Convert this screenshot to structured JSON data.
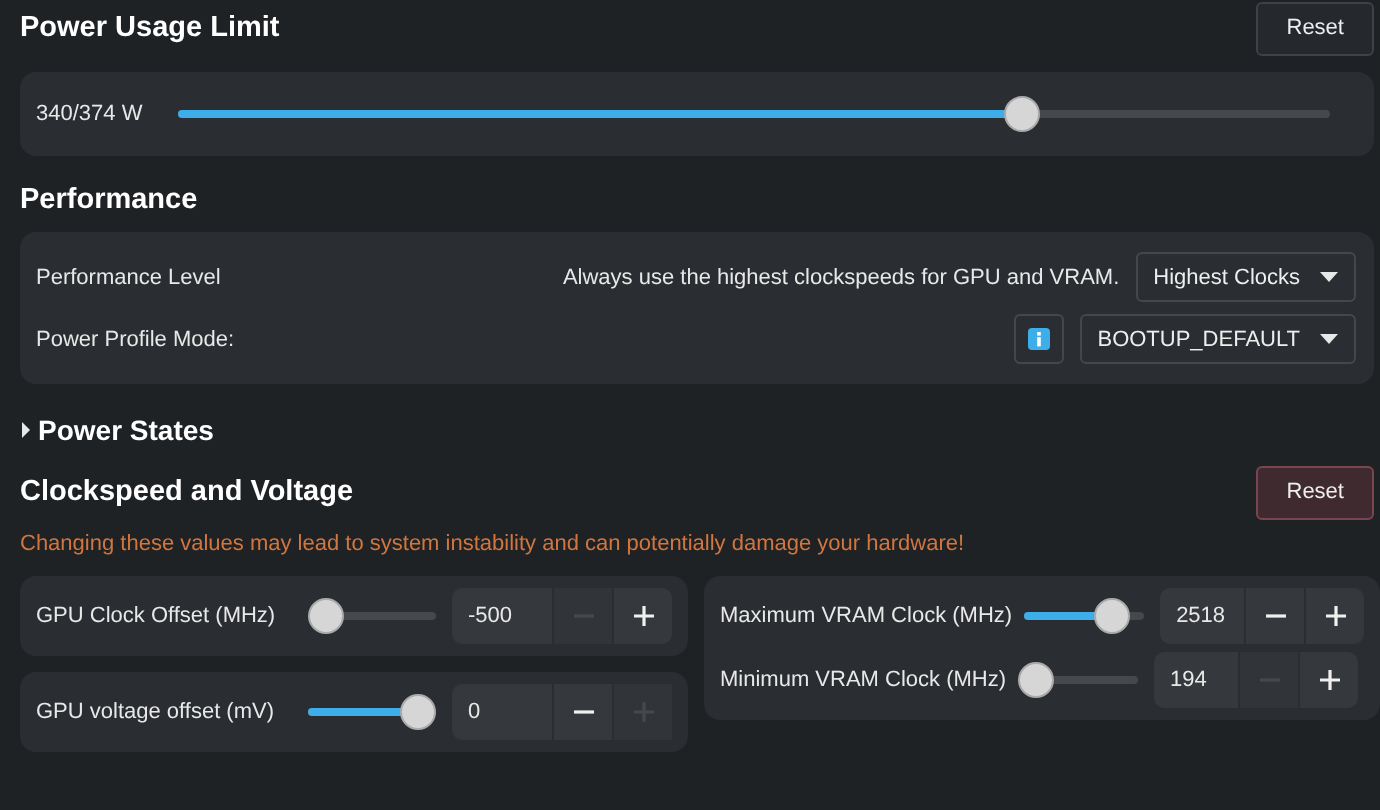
{
  "power_usage_limit": {
    "title": "Power Usage Limit",
    "reset_button": {
      "label": "Reset",
      "kind": "normal"
    },
    "reading": "340/374 W",
    "level": 0.74
  },
  "performance": {
    "title": "Performance",
    "level_row": {
      "label": "Performance Level",
      "description": "Always use the highest clockspeeds for GPU and VRAM.",
      "dropdown": "Highest Clocks"
    },
    "profile_row": {
      "label": "Power Profile Mode:",
      "dropdown": "BOOTUP_DEFAULT"
    }
  },
  "power_states": {
    "title": "Power States",
    "expanded": false
  },
  "clockspeed_voltage": {
    "title": "Clockspeed and Voltage",
    "reset_button": {
      "label": "Reset",
      "kind": "danger"
    },
    "warning": "Changing these values may lead to system instability and can potentially damage your hardware!",
    "left_cards": [
      {
        "label": "GPU Clock Offset (MHz)",
        "level": 0,
        "value": "-500",
        "minus_disabled": true,
        "plus_disabled": false
      },
      {
        "label": "GPU voltage offset (mV)",
        "level": 1,
        "value": "0",
        "minus_disabled": false,
        "plus_disabled": true
      }
    ],
    "right_card": [
      {
        "label": "Maximum VRAM Clock (MHz)",
        "level": 0.82,
        "value": "2518",
        "minus_disabled": false,
        "plus_disabled": false
      },
      {
        "label": "Minimum VRAM Clock (MHz)",
        "level": 0,
        "value": "194",
        "minus_disabled": true,
        "plus_disabled": false
      }
    ]
  }
}
